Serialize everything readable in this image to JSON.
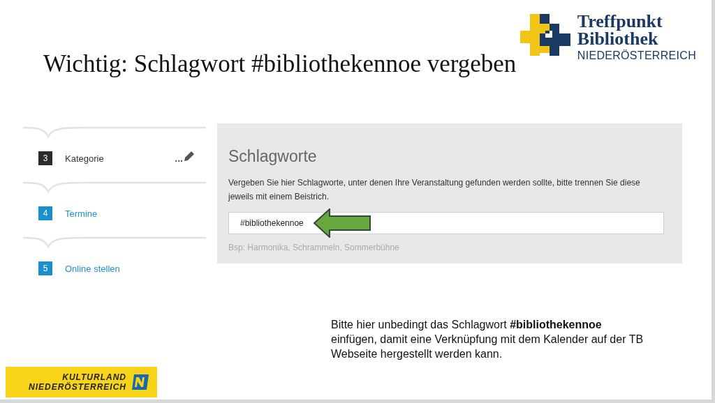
{
  "title": "Wichtig: Schlagwort #bibliothekennoe vergeben",
  "logo": {
    "line_1": "Treffpunkt",
    "line_2": "Bibliothek",
    "line_3": "NIEDERÖSTERREICH"
  },
  "steps": [
    {
      "number": "3",
      "label": "Kategorie",
      "selected": true,
      "ellipsis": "..."
    },
    {
      "number": "4",
      "label": "Termine",
      "selected": false
    },
    {
      "number": "5",
      "label": "Online stellen",
      "selected": false
    }
  ],
  "form": {
    "heading": "Schlagworte",
    "description": "Vergeben Sie hier Schlagworte, unter denen Ihre Veranstaltung gefunden werden sollte, bitte trennen Sie diese jeweils mit einem Beistrich.",
    "value": "#bibliothekennoe",
    "hint": "Bsp: Harmonika, Schrammeln, Sommerbühne"
  },
  "callout": "Bitte hier unbedingt das Schlagwort  **#bibliothekennoe** einfügen, damit eine Verknüpfung mit dem Kalender auf der TB Webseite hergestellt werden kann.",
  "footer_logo": {
    "line_1": "KULTURLAND",
    "line_2": "NIEDERÖSTERREICH"
  }
}
